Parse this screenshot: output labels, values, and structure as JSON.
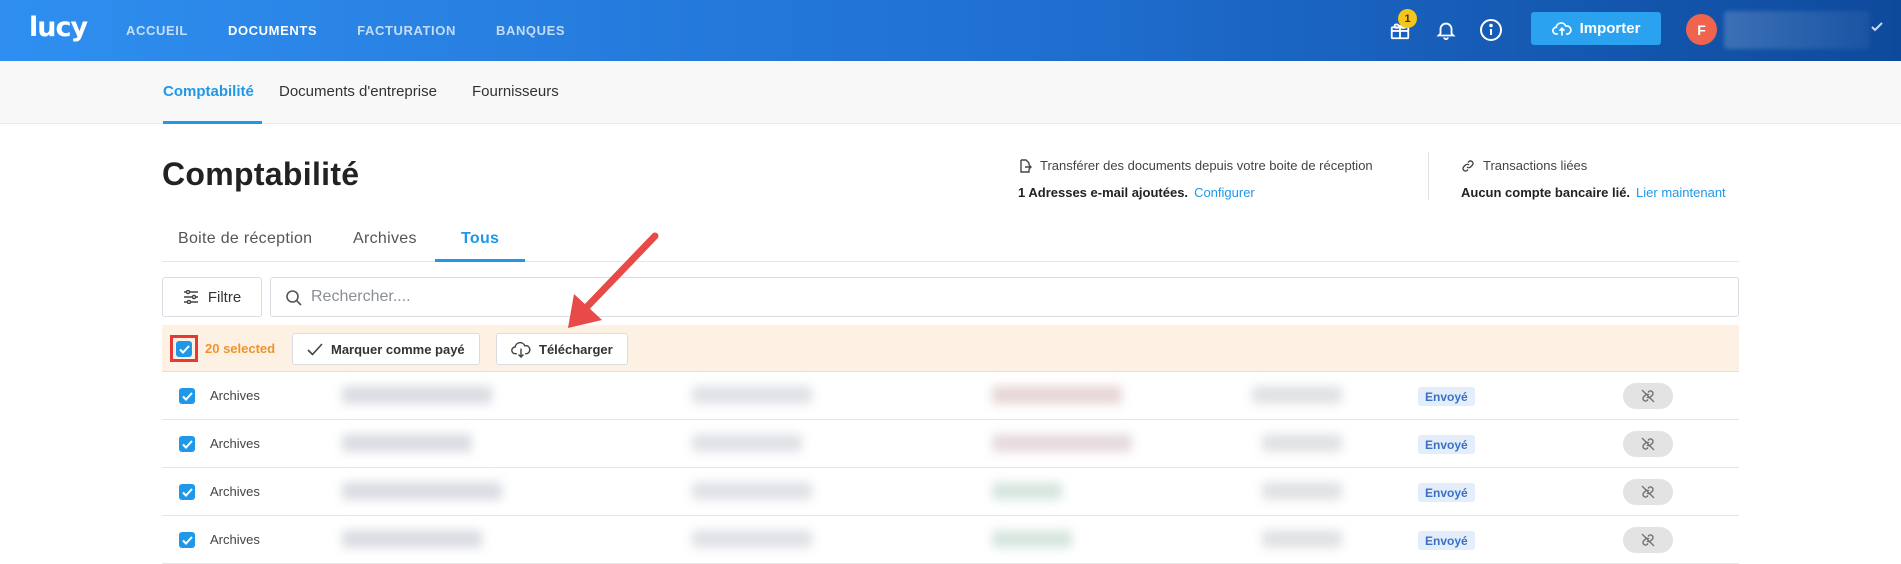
{
  "topbar": {
    "logo": "lucy",
    "nav": [
      "ACCUEIL",
      "DOCUMENTS",
      "FACTURATION",
      "BANQUES"
    ],
    "active_nav": "DOCUMENTS",
    "gift_badge": "1",
    "import_label": "Importer",
    "avatar_initial": "F",
    "accent": "#2aa2f0"
  },
  "subnav": {
    "tabs": [
      "Comptabilité",
      "Documents d'entreprise",
      "Fournisseurs"
    ],
    "active": "Comptabilité"
  },
  "page": {
    "title": "Comptabilité",
    "email_info": {
      "heading": "Transférer des documents depuis votre boite de réception",
      "status": "1 Adresses e-mail ajoutées.",
      "link": "Configurer"
    },
    "bank_info": {
      "heading": "Transactions liées",
      "status": "Aucun compte bancaire lié.",
      "link": "Lier maintenant"
    }
  },
  "tabs": {
    "items": [
      "Boite de réception",
      "Archives",
      "Tous"
    ],
    "active": "Tous"
  },
  "filters": {
    "filter_label": "Filtre",
    "search_placeholder": "Rechercher...."
  },
  "selection": {
    "count_label": "20 selected",
    "mark_paid_label": "Marquer comme payé",
    "download_label": "Télécharger"
  },
  "rows": [
    {
      "type": "Archives",
      "status": "Envoyé"
    },
    {
      "type": "Archives",
      "status": "Envoyé"
    },
    {
      "type": "Archives",
      "status": "Envoyé"
    },
    {
      "type": "Archives",
      "status": "Envoyé"
    }
  ],
  "colors": {
    "primary": "#1f98e8",
    "selection_bg": "#fdf1e4",
    "selection_text": "#f0932b",
    "highlight_frame": "#e53935",
    "arrow": "#e84a47"
  }
}
